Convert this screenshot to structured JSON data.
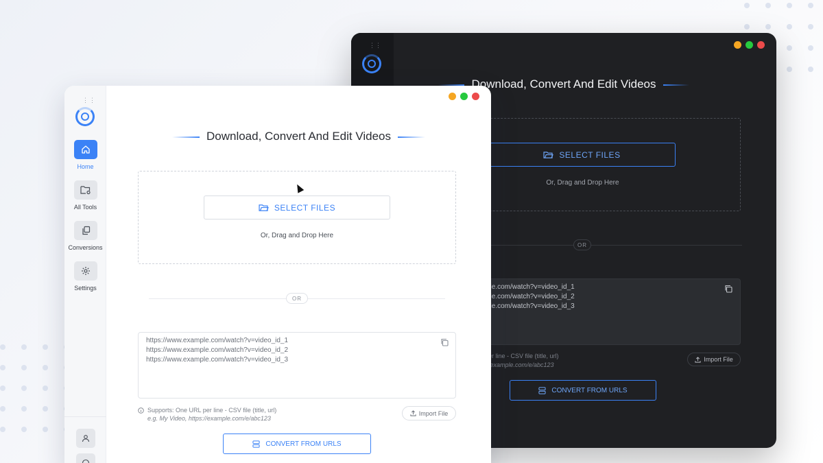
{
  "dark_window": {
    "title": "Download, Convert And Edit Videos",
    "select_files": "SELECT FILES",
    "drag_text": "Or, Drag and Drop Here",
    "or_label": "OR",
    "url_lines": [
      "ple.com/watch?v=video_id_1",
      "ple.com/watch?v=video_id_2",
      "ple.com/watch?v=video_id_3"
    ],
    "support_text": "er line - CSV file (title, url)",
    "example_text": "/example.com/e/abc123",
    "import_label": "Import File",
    "convert_label": "CONVERT FROM URLS"
  },
  "light_window": {
    "title": "Download, Convert And Edit Videos",
    "select_files": "SELECT FILES",
    "drag_text": "Or, Drag and Drop Here",
    "or_label": "OR",
    "url_lines": [
      "https://www.example.com/watch?v=video_id_1",
      "https://www.example.com/watch?v=video_id_2",
      "https://www.example.com/watch?v=video_id_3"
    ],
    "support_text": "Supports: One URL per line - CSV file (title, url)",
    "example_text": "e.g. My Video, https://example.com/e/abc123",
    "import_label": "Import File",
    "convert_label": "CONVERT FROM URLS"
  },
  "sidebar": {
    "items": [
      {
        "label": "Home",
        "icon": "home-icon",
        "active": true
      },
      {
        "label": "All Tools",
        "icon": "folder-gear-icon",
        "active": false
      },
      {
        "label": "Conversions",
        "icon": "copy-stack-icon",
        "active": false
      },
      {
        "label": "Settings",
        "icon": "gear-icon",
        "active": false
      }
    ]
  },
  "colors": {
    "accent": "#3b82f6",
    "traffic_yellow": "#f5a623",
    "traffic_green": "#27c93f",
    "traffic_red": "#ec4b4b",
    "dark_bg": "#1f2023"
  }
}
